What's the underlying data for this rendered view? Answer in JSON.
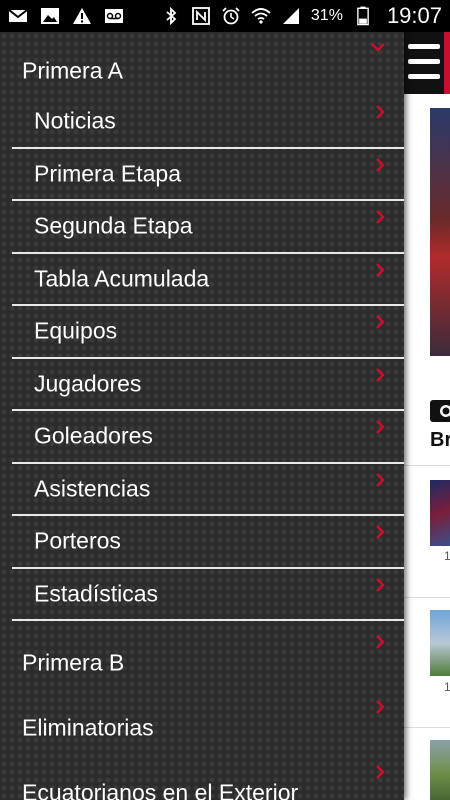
{
  "status_bar": {
    "icons_left": [
      "mail-icon",
      "image-icon",
      "warning-icon",
      "voicemail-icon"
    ],
    "icons_right": [
      "bluetooth-icon",
      "nfc-icon",
      "alarm-icon",
      "wifi-icon",
      "signal-icon",
      "battery-icon"
    ],
    "battery": "31%",
    "time": "19:07"
  },
  "drawer": {
    "section_primera_a": "Primera A",
    "submenu": [
      {
        "label": "Noticias"
      },
      {
        "label": "Primera Etapa"
      },
      {
        "label": "Segunda Etapa"
      },
      {
        "label": "Tabla Acumulada"
      },
      {
        "label": "Equipos"
      },
      {
        "label": "Jugadores"
      },
      {
        "label": "Goleadores"
      },
      {
        "label": "Asistencias"
      },
      {
        "label": "Porteros"
      },
      {
        "label": "Estadísticas"
      }
    ],
    "sections": [
      {
        "label": "Primera B"
      },
      {
        "label": "Eliminatorias"
      },
      {
        "label": "Ecuatorianos en el Exterior"
      }
    ]
  },
  "background": {
    "bold_text": "Br",
    "thumb_captions": [
      "1",
      "1"
    ]
  },
  "colors": {
    "accent": "#c8102e",
    "drawer_bg": "#2c2c2c",
    "separator": "#e9e9e9"
  }
}
